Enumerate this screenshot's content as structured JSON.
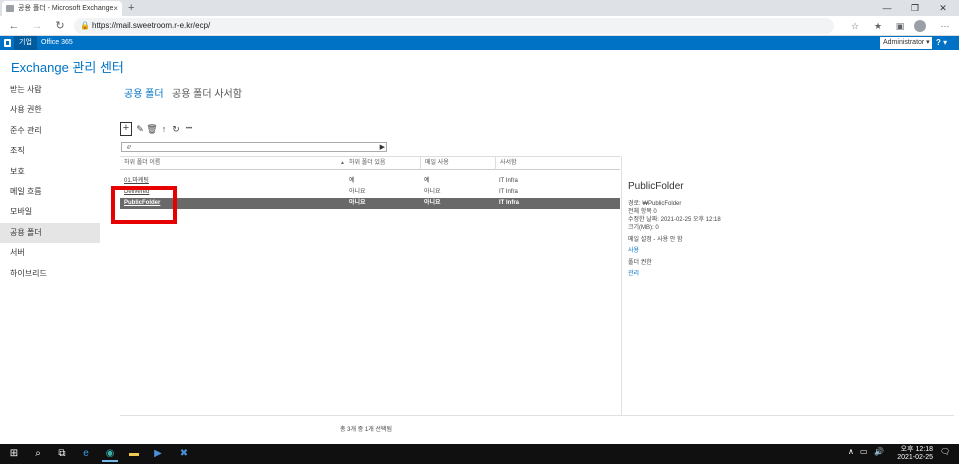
{
  "browser": {
    "tab_title": "공용 폴더 - Microsoft Exchange",
    "tab_close": "×",
    "new_tab": "+",
    "url": "https://mail.sweetroom.r-e.kr/ecp/",
    "window_controls": [
      "—",
      "❐",
      "✕"
    ]
  },
  "o365_bar": {
    "company": "기업",
    "office": "Office 365",
    "user": "Administrator ▾",
    "help": "? ▾"
  },
  "app": {
    "title": "Exchange 관리 센터"
  },
  "nav": {
    "items": [
      {
        "label": "받는 사람"
      },
      {
        "label": "사용 권한"
      },
      {
        "label": "준수 관리"
      },
      {
        "label": "조직"
      },
      {
        "label": "보호"
      },
      {
        "label": "메일 흐름"
      },
      {
        "label": "모바일"
      },
      {
        "label": "공용 폴더",
        "active": true
      },
      {
        "label": "서버"
      },
      {
        "label": "하이브리드"
      }
    ]
  },
  "pivot": {
    "active": "공용 폴더",
    "other": "공용 폴더 사서함"
  },
  "toolbar": {
    "add": "+",
    "edit": "✎",
    "delete": "🗑",
    "up": "↑",
    "refresh": "↻",
    "more": "•••"
  },
  "search": {
    "placeholder": "ℯ",
    "button": "▶"
  },
  "grid": {
    "columns": [
      "하위 폴더 이름",
      "하위 폴더 있음",
      "메일 사용",
      "사서함"
    ],
    "sort_indicator": "▲",
    "rows": [
      {
        "name": "01.마케팅",
        "has_sub": "예",
        "mail": "예",
        "mailbox": "IT Infra",
        "selected": false
      },
      {
        "name": "Delivered",
        "has_sub": "아니요",
        "mail": "아니요",
        "mailbox": "IT Infra",
        "selected": false
      },
      {
        "name": "PublicFolder",
        "has_sub": "아니요",
        "mail": "아니요",
        "mailbox": "IT Infra",
        "selected": true
      }
    ]
  },
  "details": {
    "title": "PublicFolder",
    "path": "경로: ₩PublicFolder",
    "total_items": "전체 항목 0",
    "modified": "수정한 날짜: 2021-02-25 오후 12:18",
    "size": "크기(MB): 0",
    "mail_settings": "메일 설정 - 사용 안 함",
    "enable_link": "사용",
    "folder_perms": "폴더 권한",
    "manage_link": "관리"
  },
  "footer": {
    "status": "총 3개 중 1개 선택됨"
  },
  "taskbar": {
    "time": "오후 12:18",
    "date": "2021-02-25",
    "tray_up": "∧",
    "notification": "🗨"
  },
  "colors": {
    "accent": "#0072c6",
    "selection": "#696969",
    "highlight_box": "#e60000"
  }
}
